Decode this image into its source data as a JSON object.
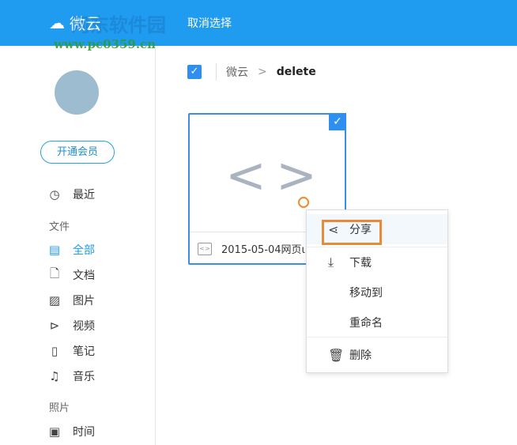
{
  "header": {
    "app_name": "微云",
    "cancel_selection": "取消选择"
  },
  "watermark": {
    "site": "河东软件园",
    "url": "www.pc0359.cn"
  },
  "sidebar": {
    "vip_button": "开通会员",
    "recent": "最近",
    "files_section": "文件",
    "file_items": [
      {
        "label": "全部",
        "icon": "list-icon"
      },
      {
        "label": "文档",
        "icon": "document-icon"
      },
      {
        "label": "图片",
        "icon": "image-icon"
      },
      {
        "label": "视频",
        "icon": "video-icon"
      },
      {
        "label": "笔记",
        "icon": "note-icon"
      },
      {
        "label": "音乐",
        "icon": "music-icon"
      }
    ],
    "photos_section": "照片",
    "time": "时间"
  },
  "breadcrumb": {
    "root": "微云",
    "separator": ">",
    "current": "delete"
  },
  "file": {
    "name": "2015-05-04网页ι"
  },
  "context_menu": {
    "share": "分享",
    "download": "下载",
    "move_to": "移动到",
    "rename": "重命名",
    "delete": "删除"
  },
  "colors": {
    "accent": "#1f9bef",
    "highlight": "#e88a38"
  }
}
